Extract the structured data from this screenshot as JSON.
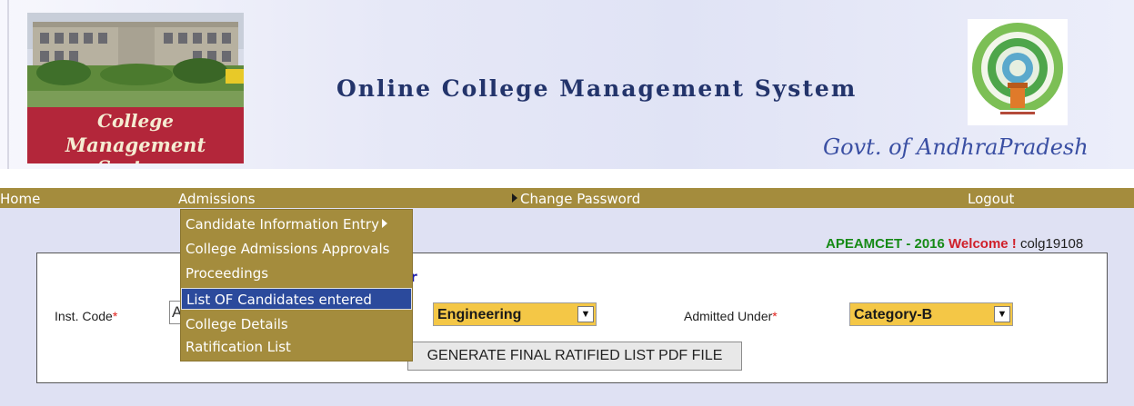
{
  "header": {
    "logo_line1": "College",
    "logo_line2": "Management System",
    "site_title": "Online College Management System",
    "govt_text": "Govt. of AndhraPradesh",
    "emblem_icon": "ap-government-emblem-icon"
  },
  "nav": {
    "home": "Home",
    "admissions": "Admissions",
    "change_password": "Change Password",
    "logout": "Logout"
  },
  "dropdown": {
    "items": [
      {
        "label": "Candidate Information Entry",
        "has_submenu": true
      },
      {
        "label": "College Admissions Approvals"
      },
      {
        "label": "Proceedings"
      },
      {
        "label": "List OF Candidates entered",
        "highlighted": true
      },
      {
        "label": "College Details"
      },
      {
        "label": "Ratification List"
      }
    ]
  },
  "welcome": {
    "exam": "APEAMCET - 2016",
    "word": "Welcome !",
    "user": "colg19108"
  },
  "form": {
    "title_visible": "ter",
    "inst_code_label": "Inst. Code",
    "inst_code_value": "A",
    "required_mark": "*",
    "course_value": "Engineering",
    "admitted_under_label": "Admitted Under",
    "category_value": "Category-B",
    "generate_button": "GENERATE FINAL RATIFIED LIST PDF FILE"
  },
  "colors": {
    "nav_bg": "#a48c3d",
    "menu_highlight": "#2b4a9c",
    "select_bg": "#f4c746",
    "exam_text": "#168a16",
    "welcome_text": "#d0202a",
    "form_title": "#1c1ca8"
  }
}
